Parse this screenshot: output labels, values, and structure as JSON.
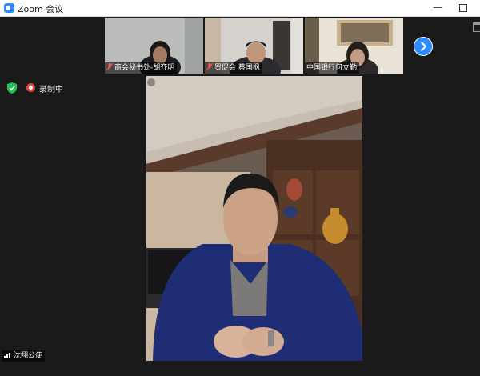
{
  "window": {
    "title": "Zoom 会议",
    "minimize_glyph": "—",
    "maximize_glyph": "□"
  },
  "thumbnails": [
    {
      "name": "商会秘书处-胡齐明",
      "muted": true
    },
    {
      "name": "贸促会 蔡国枫",
      "muted": true
    },
    {
      "name": "中国银行何立勤",
      "muted": false
    }
  ],
  "status": {
    "recording_label": "录制中",
    "accent_color": "#2d8cff",
    "recording_color": "#e0463d",
    "security_color": "#23c552"
  },
  "speaker": {
    "name": "沈翔公使"
  },
  "icons": {
    "app": "zoom-app-icon",
    "security": "shield-check-icon",
    "recording": "recording-dot-icon",
    "next": "chevron-right-icon",
    "mic_muted": "mic-muted-icon",
    "audio_level": "signal-bars-icon"
  }
}
